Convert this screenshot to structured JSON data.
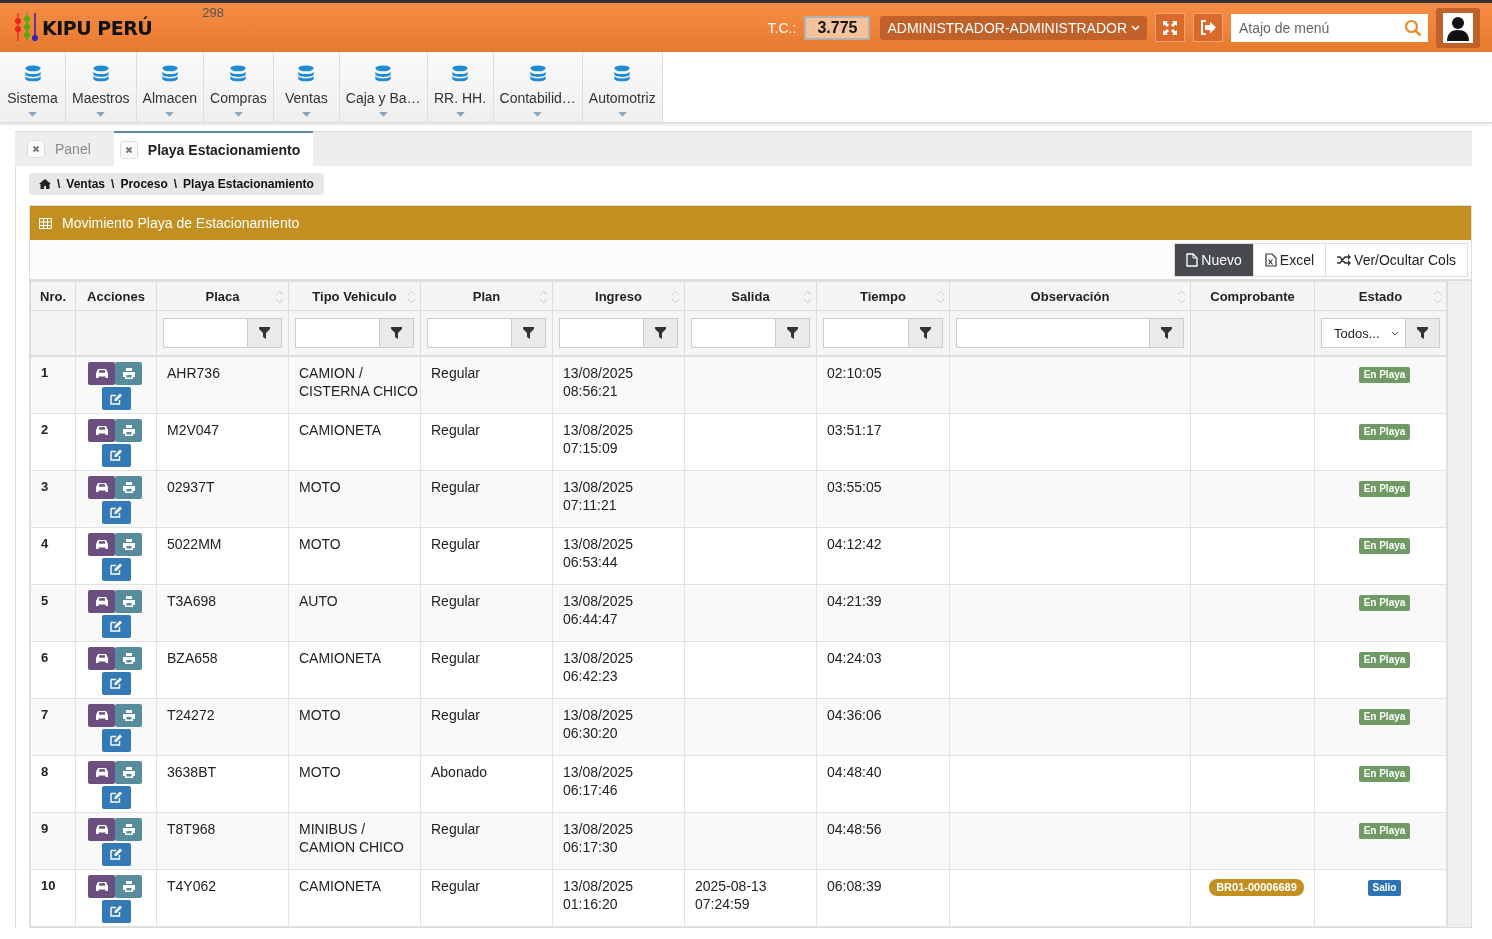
{
  "header": {
    "logo_text": "KIPU PERÚ",
    "counter": "298",
    "tc_label": "T.C.:",
    "tc_value": "3.775",
    "user": "ADMINISTRADOR-ADMINISTRADOR",
    "search": {
      "placeholder": "Atajo de menú"
    }
  },
  "menu": [
    {
      "label": "Sistema"
    },
    {
      "label": "Maestros"
    },
    {
      "label": "Almacen"
    },
    {
      "label": "Compras"
    },
    {
      "label": "Ventas"
    },
    {
      "label": "Caja y Ba…"
    },
    {
      "label": "RR. HH."
    },
    {
      "label": "Contabilid…"
    },
    {
      "label": "Automotriz"
    }
  ],
  "tabs": [
    {
      "label": "Panel",
      "selected": false
    },
    {
      "label": "Playa Estacionamiento",
      "selected": true
    }
  ],
  "breadcrumb": [
    {
      "separator": "\\",
      "label": "Ventas"
    },
    {
      "separator": "\\",
      "label": "Proceso"
    },
    {
      "separator": "\\",
      "label": "Playa Estacionamiento"
    }
  ],
  "panel": {
    "title": "Movimiento Playa de Estacionamiento"
  },
  "toolbar": [
    {
      "label": "Nuevo",
      "kind": "new"
    },
    {
      "label": "Excel",
      "kind": "excel"
    },
    {
      "label": "Ver/Ocultar Cols",
      "kind": "columns"
    }
  ],
  "table": {
    "columns": [
      {
        "label": "Nro.",
        "sortable": false,
        "kind": "plain"
      },
      {
        "label": "Acciones",
        "sortable": false,
        "kind": "plain"
      },
      {
        "label": "Placa",
        "sortable": true,
        "kind": "text_filter"
      },
      {
        "label": "Tipo Vehiculo",
        "sortable": true,
        "kind": "text_filter"
      },
      {
        "label": "Plan",
        "sortable": true,
        "kind": "text_filter"
      },
      {
        "label": "Ingreso",
        "sortable": true,
        "kind": "text_filter"
      },
      {
        "label": "Salida",
        "sortable": true,
        "kind": "text_filter"
      },
      {
        "label": "Tiempo",
        "sortable": true,
        "kind": "text_filter"
      },
      {
        "label": "Observación",
        "sortable": true,
        "kind": "text_filter"
      },
      {
        "label": "Comprobante",
        "sortable": false,
        "kind": "plain"
      },
      {
        "label": "Estado",
        "sortable": true,
        "kind": "select_filter",
        "value": "Todos..."
      }
    ],
    "rows": [
      {
        "nro": "1",
        "placa": "AHR736",
        "tipo": "CAMION /\nCISTERNA CHICO",
        "plan": "Regular",
        "ingreso": "13/08/2025\n08:56:21",
        "tiempo": "02:10:05",
        "estado": {
          "text": "En Playa",
          "kind": "parked"
        }
      },
      {
        "nro": "2",
        "placa": "M2V047",
        "tipo": "CAMIONETA",
        "plan": "Regular",
        "ingreso": "13/08/2025\n07:15:09",
        "tiempo": "03:51:17",
        "estado": {
          "text": "En Playa",
          "kind": "parked"
        }
      },
      {
        "nro": "3",
        "placa": "02937T",
        "tipo": "MOTO",
        "plan": "Regular",
        "ingreso": "13/08/2025\n07:11:21",
        "tiempo": "03:55:05",
        "estado": {
          "text": "En Playa",
          "kind": "parked"
        }
      },
      {
        "nro": "4",
        "placa": "5022MM",
        "tipo": "MOTO",
        "plan": "Regular",
        "ingreso": "13/08/2025\n06:53:44",
        "tiempo": "04:12:42",
        "estado": {
          "text": "En Playa",
          "kind": "parked"
        }
      },
      {
        "nro": "5",
        "placa": "T3A698",
        "tipo": "AUTO",
        "plan": "Regular",
        "ingreso": "13/08/2025\n06:44:47",
        "tiempo": "04:21:39",
        "estado": {
          "text": "En Playa",
          "kind": "parked"
        }
      },
      {
        "nro": "6",
        "placa": "BZA658",
        "tipo": "CAMIONETA",
        "plan": "Regular",
        "ingreso": "13/08/2025\n06:42:23",
        "tiempo": "04:24:03",
        "estado": {
          "text": "En Playa",
          "kind": "parked"
        }
      },
      {
        "nro": "7",
        "placa": "T24272",
        "tipo": "MOTO",
        "plan": "Regular",
        "ingreso": "13/08/2025\n06:30:20",
        "tiempo": "04:36:06",
        "estado": {
          "text": "En Playa",
          "kind": "parked"
        }
      },
      {
        "nro": "8",
        "placa": "3638BT",
        "tipo": "MOTO",
        "plan": "Abonado",
        "ingreso": "13/08/2025\n06:17:46",
        "tiempo": "04:48:40",
        "estado": {
          "text": "En Playa",
          "kind": "parked"
        }
      },
      {
        "nro": "9",
        "placa": "T8T968",
        "tipo": "MINIBUS /\nCAMION CHICO",
        "plan": "Regular",
        "ingreso": "13/08/2025\n06:17:30",
        "tiempo": "04:48:56",
        "estado": {
          "text": "En Playa",
          "kind": "parked"
        }
      },
      {
        "nro": "10",
        "placa": "T4Y062",
        "tipo": "CAMIONETA",
        "plan": "Regular",
        "ingreso": "13/08/2025\n01:16:20",
        "salida": "2025-08-13\n07:24:59",
        "tiempo": "06:08:39",
        "comprobante": "BR01-00006689",
        "estado": {
          "text": "Salio",
          "kind": "left"
        }
      }
    ]
  }
}
